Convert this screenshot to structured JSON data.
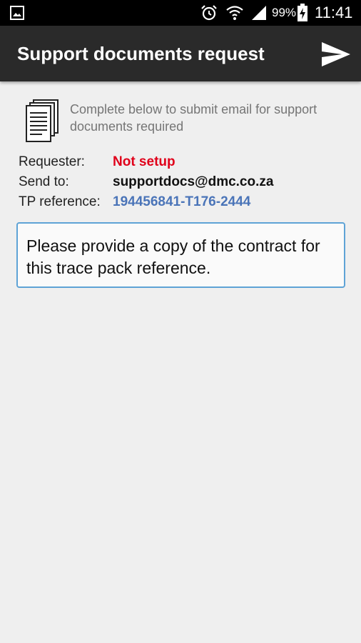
{
  "status_bar": {
    "battery_percent": "99%",
    "time": "11:41",
    "icons": [
      "gallery-icon",
      "alarm-icon",
      "wifi-icon",
      "signal-icon",
      "battery-charging-icon"
    ]
  },
  "app_bar": {
    "title": "Support documents request",
    "send_icon": "send-icon"
  },
  "intro": {
    "icon": "documents-icon",
    "text": "Complete below to submit email for support documents required"
  },
  "fields": {
    "requester": {
      "label": "Requester:",
      "value": "Not setup"
    },
    "send_to": {
      "label": "Send to:",
      "value": "supportdocs@dmc.co.za"
    },
    "tp_reference": {
      "label": "TP reference:",
      "value": "194456841-T176-2444"
    }
  },
  "message": {
    "value": "Please provide a copy of the contract for this trace pack reference."
  },
  "colors": {
    "status_bar_bg": "#000000",
    "app_bar_bg": "#2a2a2a",
    "page_bg": "#efefef",
    "error_red": "#e0001a",
    "link_blue": "#4a74b8",
    "input_border": "#5ea3d6"
  }
}
